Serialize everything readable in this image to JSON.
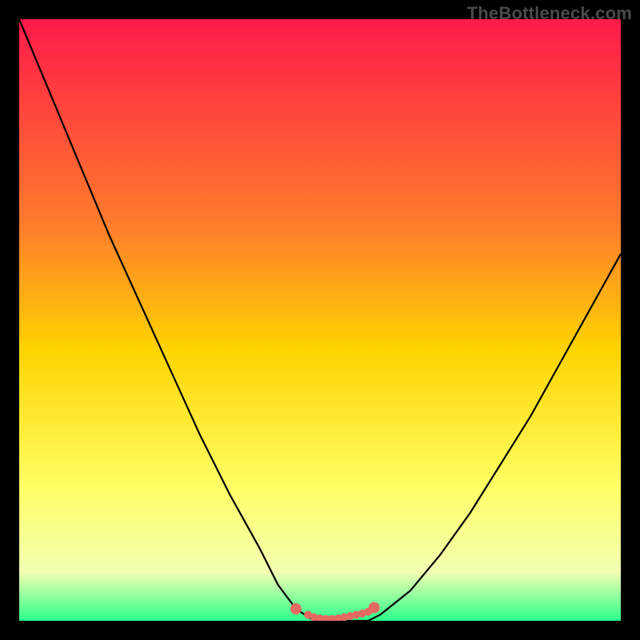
{
  "watermark": "TheBottleneck.com",
  "colors": {
    "background": "#000000",
    "curve": "#000000",
    "marker": "#e46a5f",
    "gradient_top": "#ff1a4a",
    "gradient_mid_upper": "#ff7f2a",
    "gradient_mid": "#ffd400",
    "gradient_mid_lower": "#ffff66",
    "gradient_lower": "#f2ffb3",
    "gradient_bottom": "#2bff8a"
  },
  "chart_data": {
    "type": "line",
    "title": "",
    "xlabel": "",
    "ylabel": "",
    "xlim": [
      0,
      100
    ],
    "ylim": [
      0,
      100
    ],
    "x": [
      0,
      5,
      10,
      15,
      20,
      25,
      30,
      35,
      40,
      43,
      46,
      49,
      52,
      55,
      58,
      60,
      65,
      70,
      75,
      80,
      85,
      90,
      95,
      100
    ],
    "values": [
      100,
      88,
      76,
      64,
      53,
      42,
      31,
      21,
      12,
      6,
      2,
      0,
      0,
      0,
      0,
      1,
      5,
      11,
      18,
      26,
      34,
      43,
      52,
      61
    ],
    "markers_x": [
      46,
      48,
      49,
      50,
      51,
      52,
      53,
      54,
      55,
      56,
      57,
      58,
      59
    ],
    "markers_y": [
      2,
      1,
      0.6,
      0.4,
      0.3,
      0.3,
      0.4,
      0.6,
      0.8,
      1.0,
      1.2,
      1.5,
      2.2
    ]
  }
}
